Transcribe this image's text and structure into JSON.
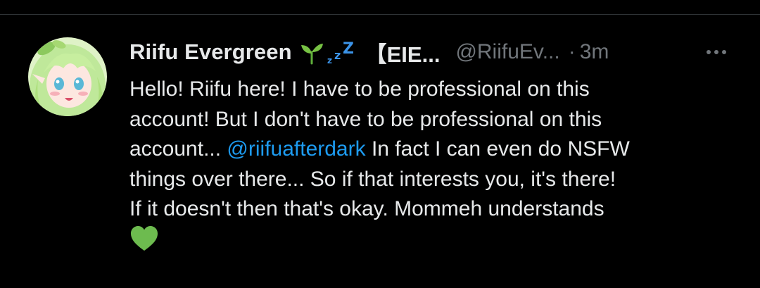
{
  "tweet": {
    "author_name": "Riifu Evergreen",
    "name_badge": "【EIE...",
    "handle": "@RiifuEv...",
    "separator": "·",
    "timestamp": "3m",
    "body_lines": [
      "Hello! Riifu here! I have to be professional on this",
      "account! But I don't have to be professional on this",
      "account... ",
      "things over there... So if that interests you, it's there!",
      "If it doesn't then that's okay. Mommeh understands"
    ],
    "mention": "@riifuafterdark",
    "line3_after_mention": " In fact I can even do NSFW",
    "emojis": [
      "seedling",
      "zzz",
      "green-heart"
    ]
  },
  "colors": {
    "background": "#000000",
    "text": "#e7e9ea",
    "muted": "#71767b",
    "link": "#1d9bf0",
    "heart": "#6dbb4f"
  },
  "icons": {
    "more": "more-options-icon",
    "avatar": "avatar"
  }
}
